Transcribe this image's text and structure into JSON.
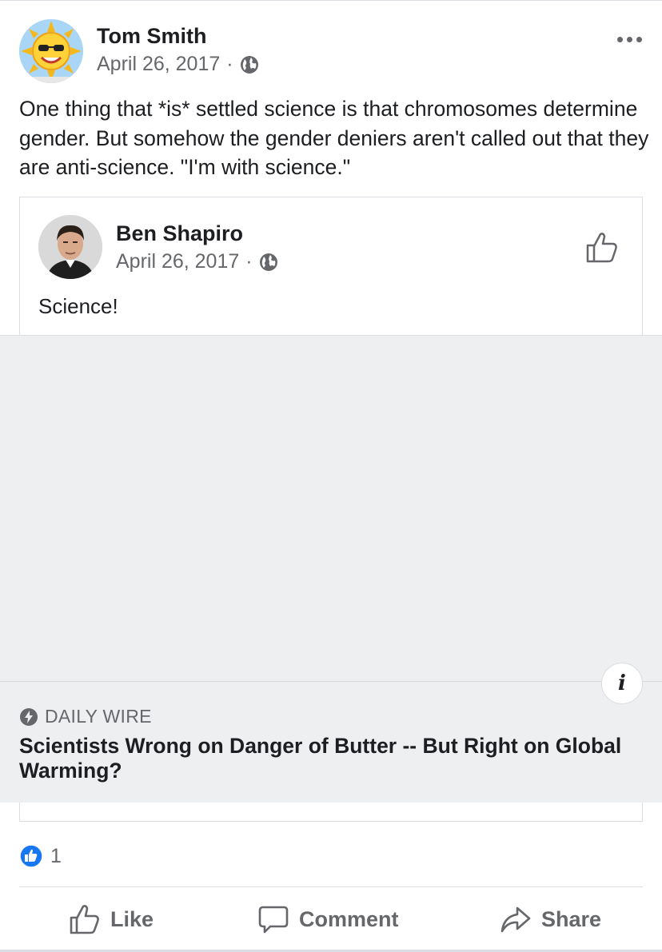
{
  "post": {
    "author": "Tom Smith",
    "date": "April 26, 2017",
    "separator": "·",
    "privacy_icon": "globe-icon",
    "text": "One thing that *is* settled science is that chromosomes determine gender. But somehow the gender deniers aren't called out that they are anti-science. \"I'm with science.\""
  },
  "shared_post": {
    "author": "Ben Shapiro",
    "date": "April 26, 2017",
    "separator": "·",
    "text": "Science!",
    "link": {
      "source": "DAILY WIRE",
      "title": "Scientists Wrong on Danger of Butter -- But Right on Global Warming?",
      "info_label": "i"
    }
  },
  "reactions": {
    "count": "1",
    "icon": "like-reaction-icon"
  },
  "actions": {
    "like": "Like",
    "comment": "Comment",
    "share": "Share"
  },
  "colors": {
    "text": "#1c1e21",
    "secondary": "#65676b",
    "media_bg": "#eeeff1",
    "like_blue": "#1877f2",
    "divider": "#dadde1"
  }
}
